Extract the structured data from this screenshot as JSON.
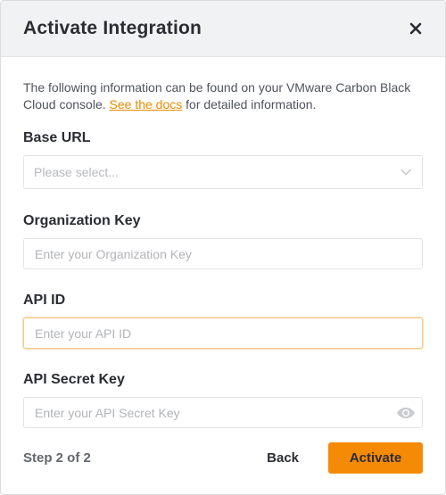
{
  "header": {
    "title": "Activate Integration",
    "close_icon": "close-icon"
  },
  "intro": {
    "text_before": "The following information can be found on your VMware Carbon Black Cloud console. ",
    "link_text": "See the docs",
    "text_after": " for detailed information."
  },
  "fields": {
    "base_url": {
      "label": "Base URL",
      "placeholder": "Please select...",
      "icon": "chevron-down-icon"
    },
    "org_key": {
      "label": "Organization Key",
      "placeholder": "Enter your Organization Key",
      "value": ""
    },
    "api_id": {
      "label": "API ID",
      "placeholder": "Enter your API ID",
      "value": ""
    },
    "api_secret": {
      "label": "API Secret Key",
      "placeholder": "Enter your API Secret Key",
      "value": "",
      "icon": "eye-icon"
    }
  },
  "footer": {
    "step": "Step 2 of 2",
    "back_label": "Back",
    "activate_label": "Activate"
  },
  "colors": {
    "accent": "#f58a07",
    "link": "#e88a00",
    "header_bg": "#f1f2f3",
    "focus_border": "#f6c88a"
  }
}
